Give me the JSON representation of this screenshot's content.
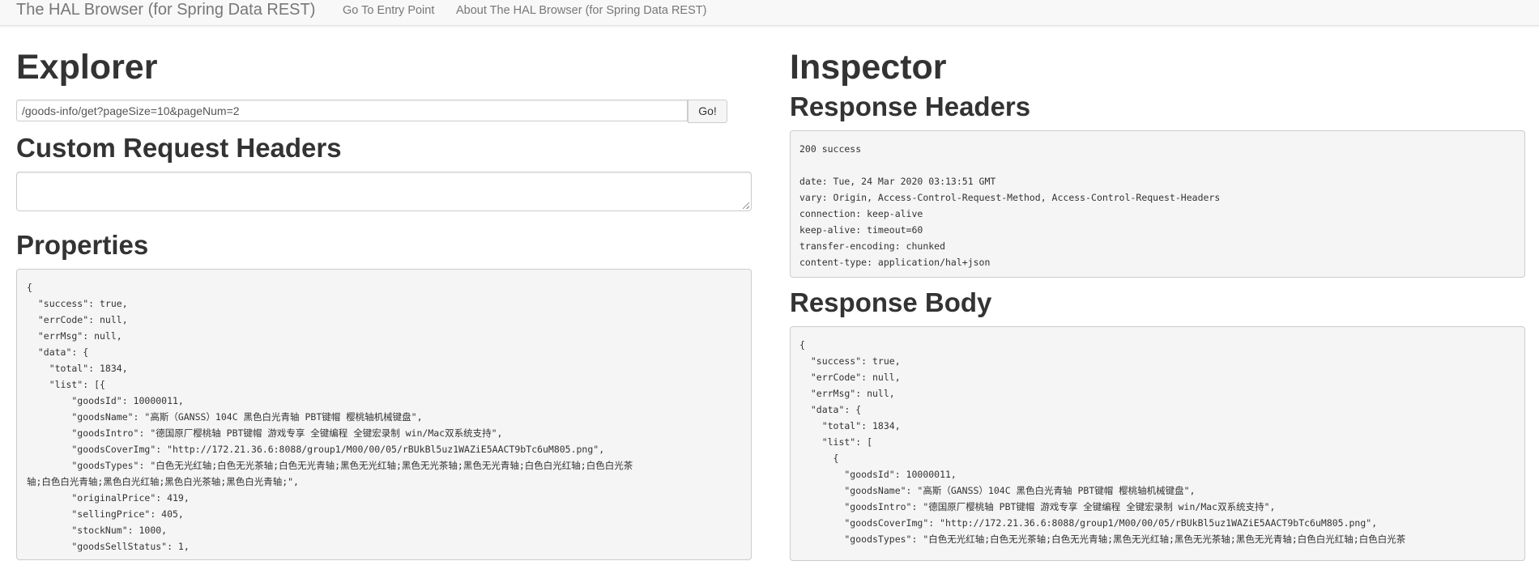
{
  "navbar": {
    "brand": "The HAL Browser (for Spring Data REST)",
    "entry_point": "Go To Entry Point",
    "about": "About The HAL Browser (for Spring Data REST)"
  },
  "explorer": {
    "title": "Explorer",
    "url_value": "/goods-info/get?pageSize=10&pageNum=2",
    "go_label": "Go!",
    "custom_headers_title": "Custom Request Headers",
    "custom_headers_value": "",
    "properties_title": "Properties",
    "properties_json": "{\n  \"success\": true,\n  \"errCode\": null,\n  \"errMsg\": null,\n  \"data\": {\n    \"total\": 1834,\n    \"list\": [{\n        \"goodsId\": 10000011,\n        \"goodsName\": \"高斯（GANSS）104C 黑色白光青轴 PBT键帽 樱桃轴机械键盘\",\n        \"goodsIntro\": \"德国原厂樱桃轴 PBT键帽 游戏专享 全键编程 全键宏录制 win/Mac双系统支持\",\n        \"goodsCoverImg\": \"http://172.21.36.6:8088/group1/M00/00/05/rBUkBl5uz1WAZiE5AACT9bTc6uM805.png\",\n        \"goodsTypes\": \"白色无光红轴;白色无光茶轴;白色无光青轴;黑色无光红轴;黑色无光茶轴;黑色无光青轴;白色白光红轴;白色白光茶\n轴;白色白光青轴;黑色白光红轴;黑色白光茶轴;黑色白光青轴;\",\n        \"originalPrice\": 419,\n        \"sellingPrice\": 405,\n        \"stockNum\": 1000,\n        \"goodsSellStatus\": 1,"
  },
  "inspector": {
    "title": "Inspector",
    "response_headers_title": "Response Headers",
    "response_headers_text": "200 success\n\ndate: Tue, 24 Mar 2020 03:13:51 GMT\nvary: Origin, Access-Control-Request-Method, Access-Control-Request-Headers\nconnection: keep-alive\nkeep-alive: timeout=60\ntransfer-encoding: chunked\ncontent-type: application/hal+json",
    "response_body_title": "Response Body",
    "response_body_json": "{\n  \"success\": true,\n  \"errCode\": null,\n  \"errMsg\": null,\n  \"data\": {\n    \"total\": 1834,\n    \"list\": [\n      {\n        \"goodsId\": 10000011,\n        \"goodsName\": \"高斯（GANSS）104C 黑色白光青轴 PBT键帽 樱桃轴机械键盘\",\n        \"goodsIntro\": \"德国原厂樱桃轴 PBT键帽 游戏专享 全键编程 全键宏录制 win/Mac双系统支持\",\n        \"goodsCoverImg\": \"http://172.21.36.6:8088/group1/M00/00/05/rBUkBl5uz1WAZiE5AACT9bTc6uM805.png\",\n        \"goodsTypes\": \"白色无光红轴;白色无光茶轴;白色无光青轴;黑色无光红轴;黑色无光茶轴;黑色无光青轴;白色白光红轴;白色白光茶"
  }
}
